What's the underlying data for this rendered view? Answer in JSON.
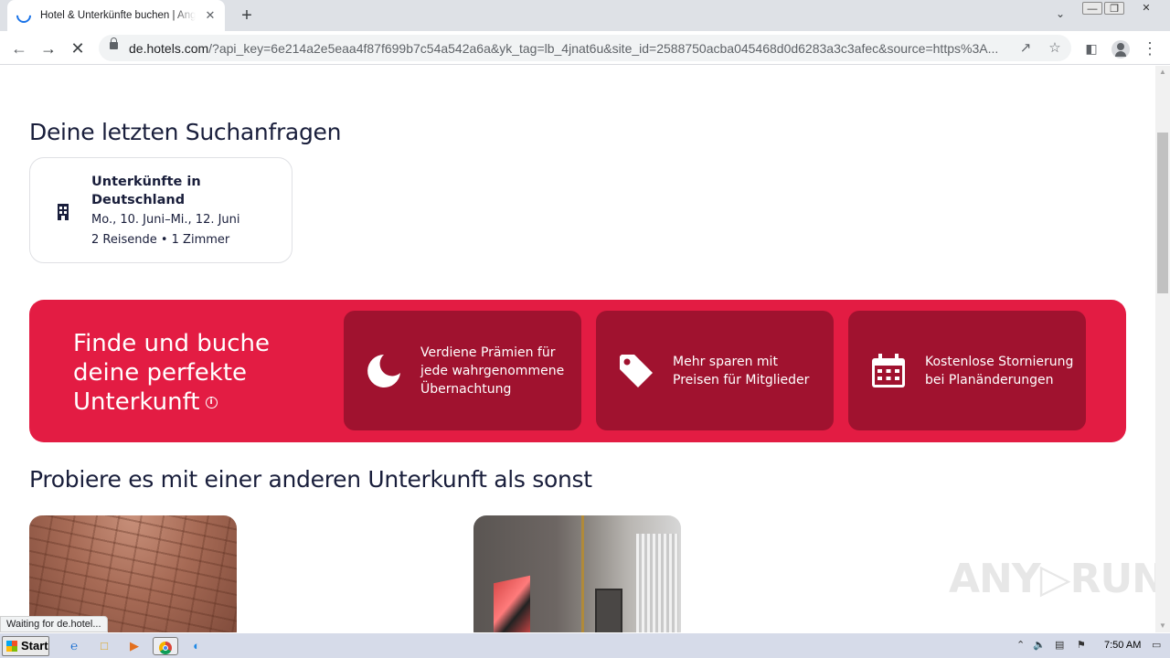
{
  "browser": {
    "tab_title": "Hotel & Unterkünfte buchen | Angebote",
    "tab_close_glyph": "✕",
    "new_tab_glyph": "+",
    "url_host": "de.hotels.com",
    "url_path": "/?api_key=6e214a2e5eaa4f87f699b7c54a542a6a&yk_tag=lb_4jnat6u&site_id=2588750acba045468d0d6283a3c3afec&source=https%3A..."
  },
  "page": {
    "recent_heading": "Deine letzten Suchanfragen",
    "recent_card": {
      "title": "Unterkünfte in Deutschland",
      "dates": "Mo., 10. Juni–Mi., 12. Juni",
      "guests": "2 Reisende • 1 Zimmer",
      "icon": "hotel-building-icon"
    },
    "promo": {
      "title": "Finde und buche deine perfekte Unterkunft",
      "info_glyph": "i",
      "background_color": "#e31c43",
      "perks": [
        {
          "icon": "moon-icon",
          "text": "Verdiene Prämien für jede wahrgenommene Übernachtung"
        },
        {
          "icon": "price-tag-icon",
          "text": "Mehr sparen mit Preisen für Mitglieder"
        },
        {
          "icon": "calendar-icon",
          "text": "Kostenlose Stornierung bei Planänderungen"
        }
      ]
    },
    "alt_heading": "Probiere es mit einer anderen Unterkunft als sonst",
    "status_text": "Waiting for de.hotel..."
  },
  "watermark": "ANY▷RUN",
  "taskbar": {
    "start_label": "Start",
    "clock": "7:50 AM"
  }
}
